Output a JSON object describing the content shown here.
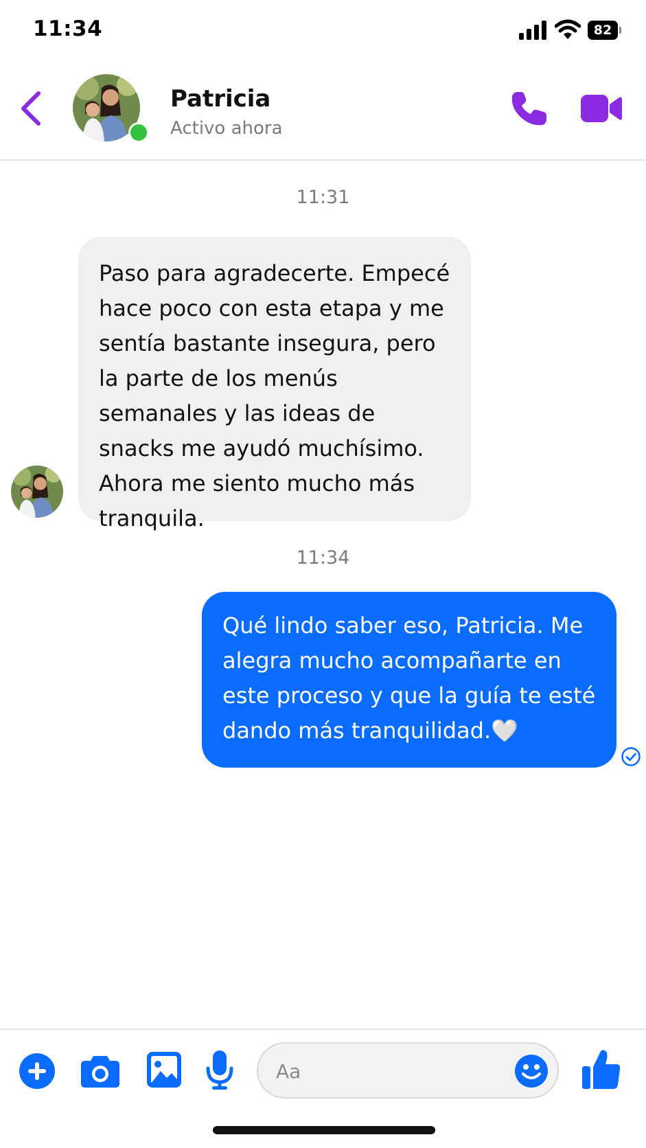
{
  "status_bar": {
    "time": "11:34",
    "battery": "82"
  },
  "header": {
    "contact_name": "Patricia",
    "contact_status": "Activo ahora",
    "icons": {
      "back": "chevron-left-icon",
      "call": "phone-icon",
      "video": "video-camera-icon"
    },
    "accent_color": "#8a2be2"
  },
  "conversation": {
    "messages": [
      {
        "timestamp": "11:31",
        "direction": "incoming",
        "text": "Paso para agradecerte. Empecé hace poco con esta etapa y me sentía bastante insegura, pero la parte de los menús semanales y las ideas de snacks me ayudó muchísimo. Ahora me siento mucho más tranquila."
      },
      {
        "timestamp": "11:34",
        "direction": "outgoing",
        "text": "Qué lindo saber eso, Patricia. Me alegra mucho acompañarte en este proceso y que la guía te esté dando más tranquilidad.🤍",
        "status": "read"
      }
    ],
    "bubble_colors": {
      "incoming": "#f0f0f0",
      "outgoing": "#0a6cff"
    }
  },
  "composer": {
    "placeholder": "Aa",
    "value": "",
    "tools": [
      "plus-circle-icon",
      "camera-icon",
      "image-icon",
      "microphone-icon"
    ],
    "emoji_icon": "smiley-icon",
    "like_icon": "thumbs-up-icon",
    "accent_color": "#0a6cff"
  }
}
